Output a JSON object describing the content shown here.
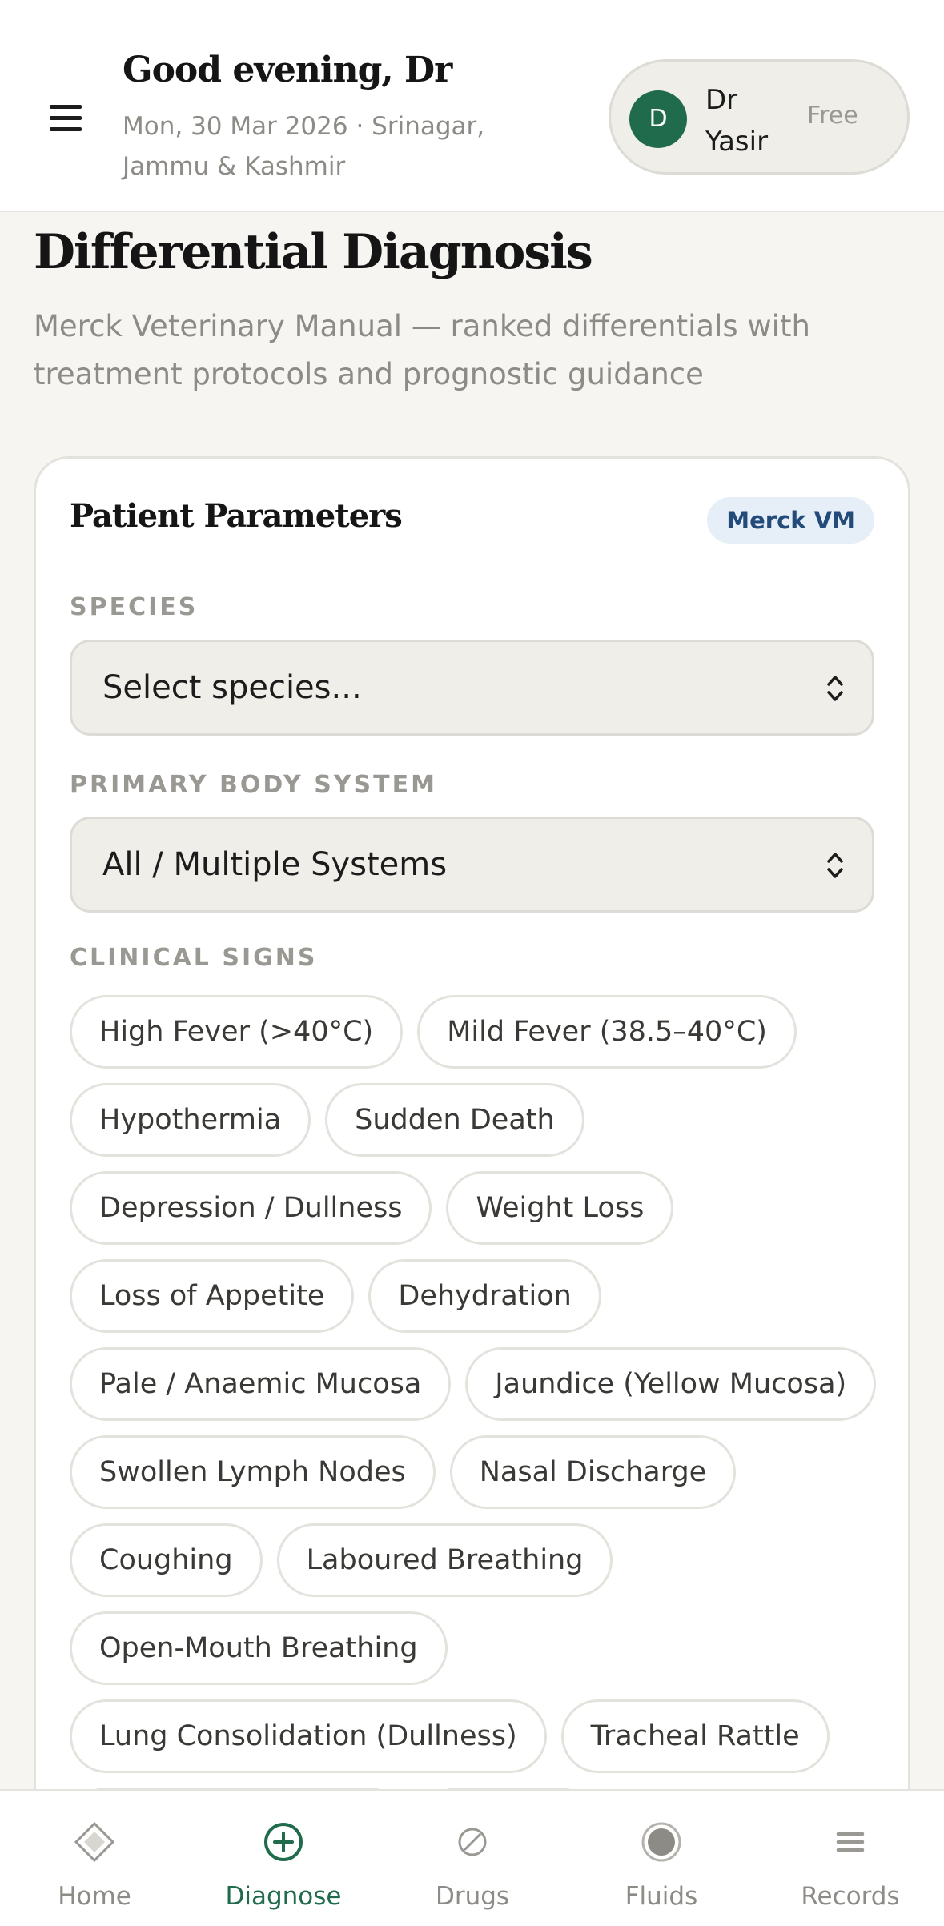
{
  "header": {
    "greeting": "Good evening, Dr",
    "subline": "Mon, 30 Mar 2026 · Srinagar, Jammu & Kashmir",
    "user": {
      "initial": "D",
      "name": "Dr Yasir",
      "plan": "Free"
    }
  },
  "page": {
    "title": "Differential Diagnosis",
    "description": "Merck Veterinary Manual — ranked differentials with treatment protocols and prognostic guidance"
  },
  "card": {
    "title": "Patient Parameters",
    "badge": "Merck VM",
    "species": {
      "label": "SPECIES",
      "value": "Select species..."
    },
    "body_system": {
      "label": "PRIMARY BODY SYSTEM",
      "value": "All / Multiple Systems"
    },
    "clinical_signs": {
      "label": "CLINICAL SIGNS",
      "rows": [
        [
          "High Fever (>40°C)",
          "Mild Fever (38.5–40°C)"
        ],
        [
          "Hypothermia",
          "Sudden Death"
        ],
        [
          "Depression / Dullness",
          "Weight Loss"
        ],
        [
          "Loss of Appetite",
          "Dehydration"
        ],
        [
          "Pale / Anaemic Mucosa",
          "Jaundice (Yellow Mucosa)"
        ],
        [
          "Swollen Lymph Nodes",
          "Nasal Discharge"
        ],
        [
          "Coughing",
          "Laboured Breathing"
        ],
        [
          "Open-Mouth Breathing"
        ],
        [
          "Lung Consolidation (Dullness)",
          "Tracheal Rattle"
        ]
      ]
    }
  },
  "nav": {
    "items": [
      {
        "label": "Home",
        "icon": "diamond-icon"
      },
      {
        "label": "Diagnose",
        "icon": "plus-circle-icon",
        "active": true
      },
      {
        "label": "Drugs",
        "icon": "pill-icon"
      },
      {
        "label": "Fluids",
        "icon": "drop-circle-icon"
      },
      {
        "label": "Records",
        "icon": "list-icon"
      }
    ]
  },
  "colors": {
    "accent": "#1f6b4b",
    "background": "#f6f5f1",
    "badge_bg": "#e6eef7",
    "badge_text": "#234b7a"
  }
}
